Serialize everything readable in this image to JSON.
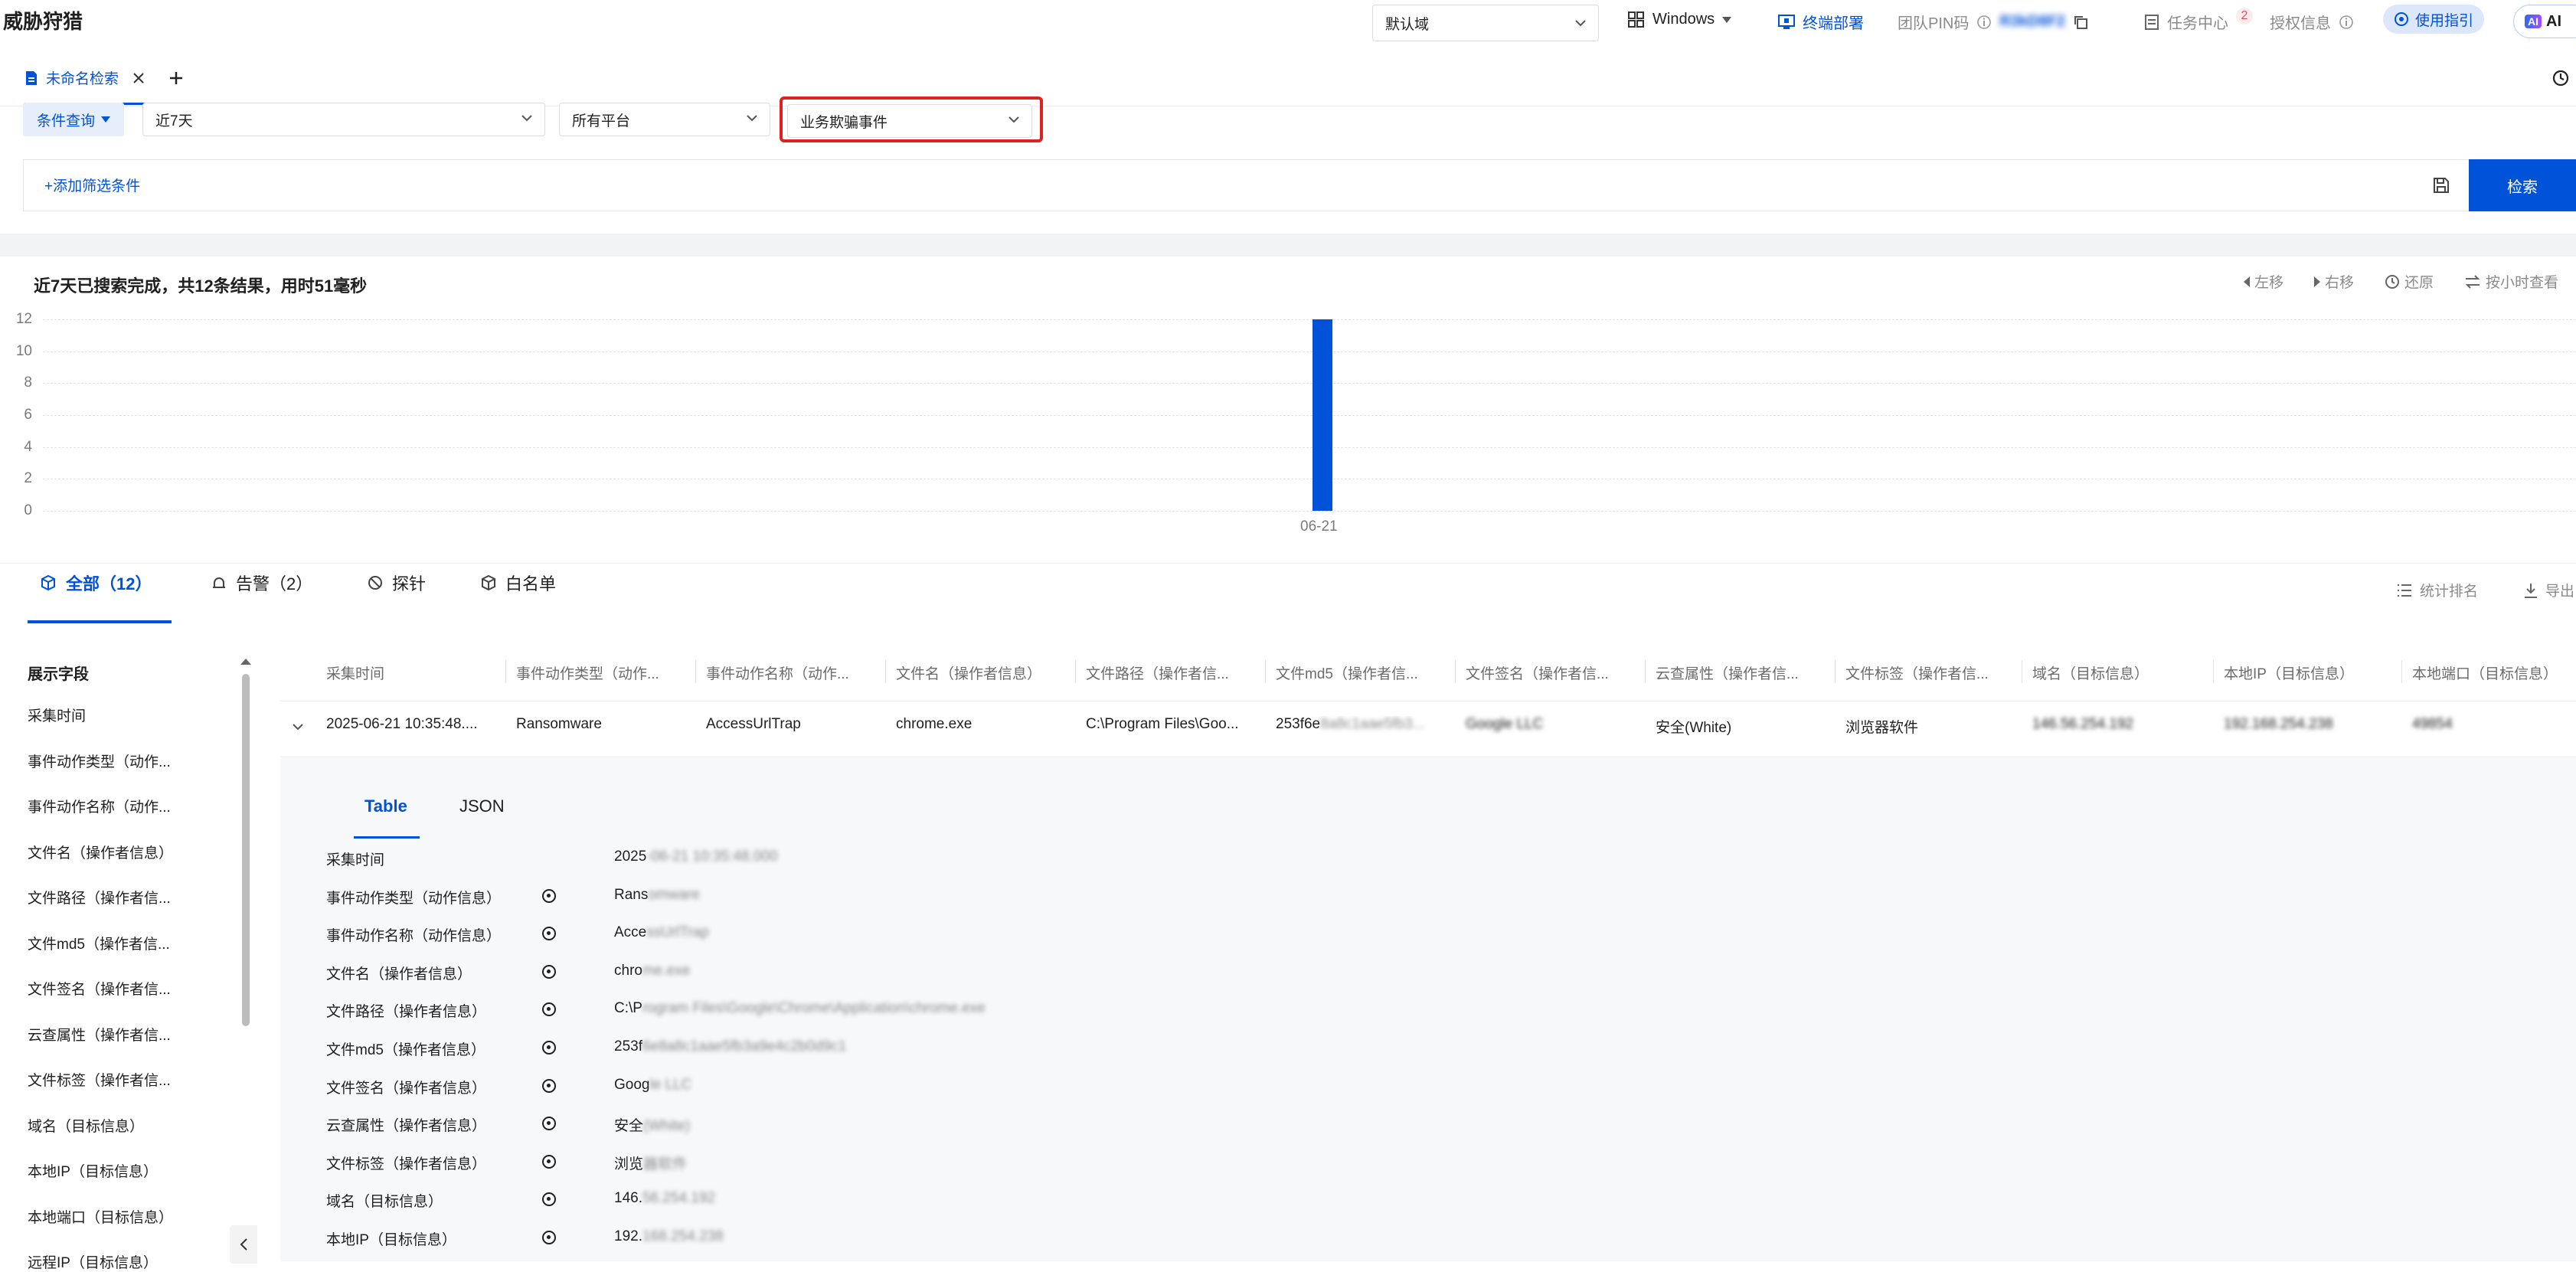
{
  "app": {
    "title": "威胁狩猎"
  },
  "topbar": {
    "domain_select": "默认域",
    "os_select": "Windows",
    "deploy": "终端部署",
    "pin_label": "团队PIN码",
    "pin_value": "R3kD8F2",
    "task_center": "任务中心",
    "task_badge": "2",
    "license": "授权信息",
    "guide": "使用指引",
    "ai": "AI"
  },
  "query_tab": {
    "label": "未命名检索"
  },
  "filters": {
    "mode": "条件查询",
    "time": "近7天",
    "platform": "所有平台",
    "event": "业务欺骗事件",
    "add_filter": "+添加筛选条件",
    "search_button": "检索"
  },
  "summary": {
    "text": "近7天已搜索完成，共12条结果，用时51毫秒",
    "move_left": "左移",
    "move_right": "右移",
    "restore": "还原",
    "by_hour": "按小时查看"
  },
  "chart_data": {
    "type": "bar",
    "categories": [
      "06-21"
    ],
    "values": [
      12
    ],
    "ylim": [
      0,
      12
    ],
    "yticks": [
      "12",
      "10",
      "8",
      "6",
      "4",
      "2",
      "0"
    ],
    "grid": true,
    "bar_color": "#0052d9"
  },
  "result_tabs": {
    "all": "全部（12）",
    "alert": "告警（2）",
    "probe": "探针",
    "whitelist": "白名单",
    "stats": "统计排名",
    "export": "导出"
  },
  "fields_panel": {
    "title": "展示字段",
    "items": [
      "采集时间",
      "事件动作类型（动作...",
      "事件动作名称（动作...",
      "文件名（操作者信息）",
      "文件路径（操作者信...",
      "文件md5（操作者信...",
      "文件签名（操作者信...",
      "云查属性（操作者信...",
      "文件标签（操作者信...",
      "域名（目标信息）",
      "本地IP（目标信息）",
      "本地端口（目标信息）",
      "远程IP（目标信息）"
    ]
  },
  "table": {
    "columns": [
      "采集时间",
      "事件动作类型（动作...",
      "事件动作名称（动作...",
      "文件名（操作者信息）",
      "文件路径（操作者信...",
      "文件md5（操作者信...",
      "文件签名（操作者信...",
      "云查属性（操作者信...",
      "文件标签（操作者信...",
      "域名（目标信息）",
      "本地IP（目标信息）",
      "本地端口（目标信息）"
    ],
    "row": [
      "2025-06-21 10:35:48....",
      "Ransomware",
      "AccessUrlTrap",
      "chrome.exe",
      "C:\\Program Files\\Goo...",
      "253f6e8a8c1aae5fb3...",
      "Google LLC",
      "安全(White)",
      "浏览器软件",
      "146.56.254.192",
      "192.168.254.238",
      "49854"
    ]
  },
  "detail": {
    "tab_table": "Table",
    "tab_json": "JSON",
    "rows": [
      {
        "label": "采集时间",
        "value": "2025",
        "hidden": "-06-21 10:35:48.000"
      },
      {
        "label": "事件动作类型（动作信息）",
        "value": "Rans",
        "hidden": "omware"
      },
      {
        "label": "事件动作名称（动作信息）",
        "value": "Acce",
        "hidden": "ssUrlTrap"
      },
      {
        "label": "文件名（操作者信息）",
        "value": "chro",
        "hidden": "me.exe"
      },
      {
        "label": "文件路径（操作者信息）",
        "value": "C:\\P",
        "hidden": "rogram Files\\Google\\Chrome\\Application\\chrome.exe"
      },
      {
        "label": "文件md5（操作者信息）",
        "value": "253f",
        "hidden": "6e8a8c1aae5fb3a9e4c2b0d9c1"
      },
      {
        "label": "文件签名（操作者信息）",
        "value": "Goog",
        "hidden": "le LLC"
      },
      {
        "label": "云查属性（操作者信息）",
        "value": "安全",
        "hidden": "(White)"
      },
      {
        "label": "文件标签（操作者信息）",
        "value": "浏览",
        "hidden": "器软件"
      },
      {
        "label": "域名（目标信息）",
        "value": "146.",
        "hidden": "56.254.192"
      },
      {
        "label": "本地IP（目标信息）",
        "value": "192.",
        "hidden": "168.254.238"
      }
    ]
  }
}
